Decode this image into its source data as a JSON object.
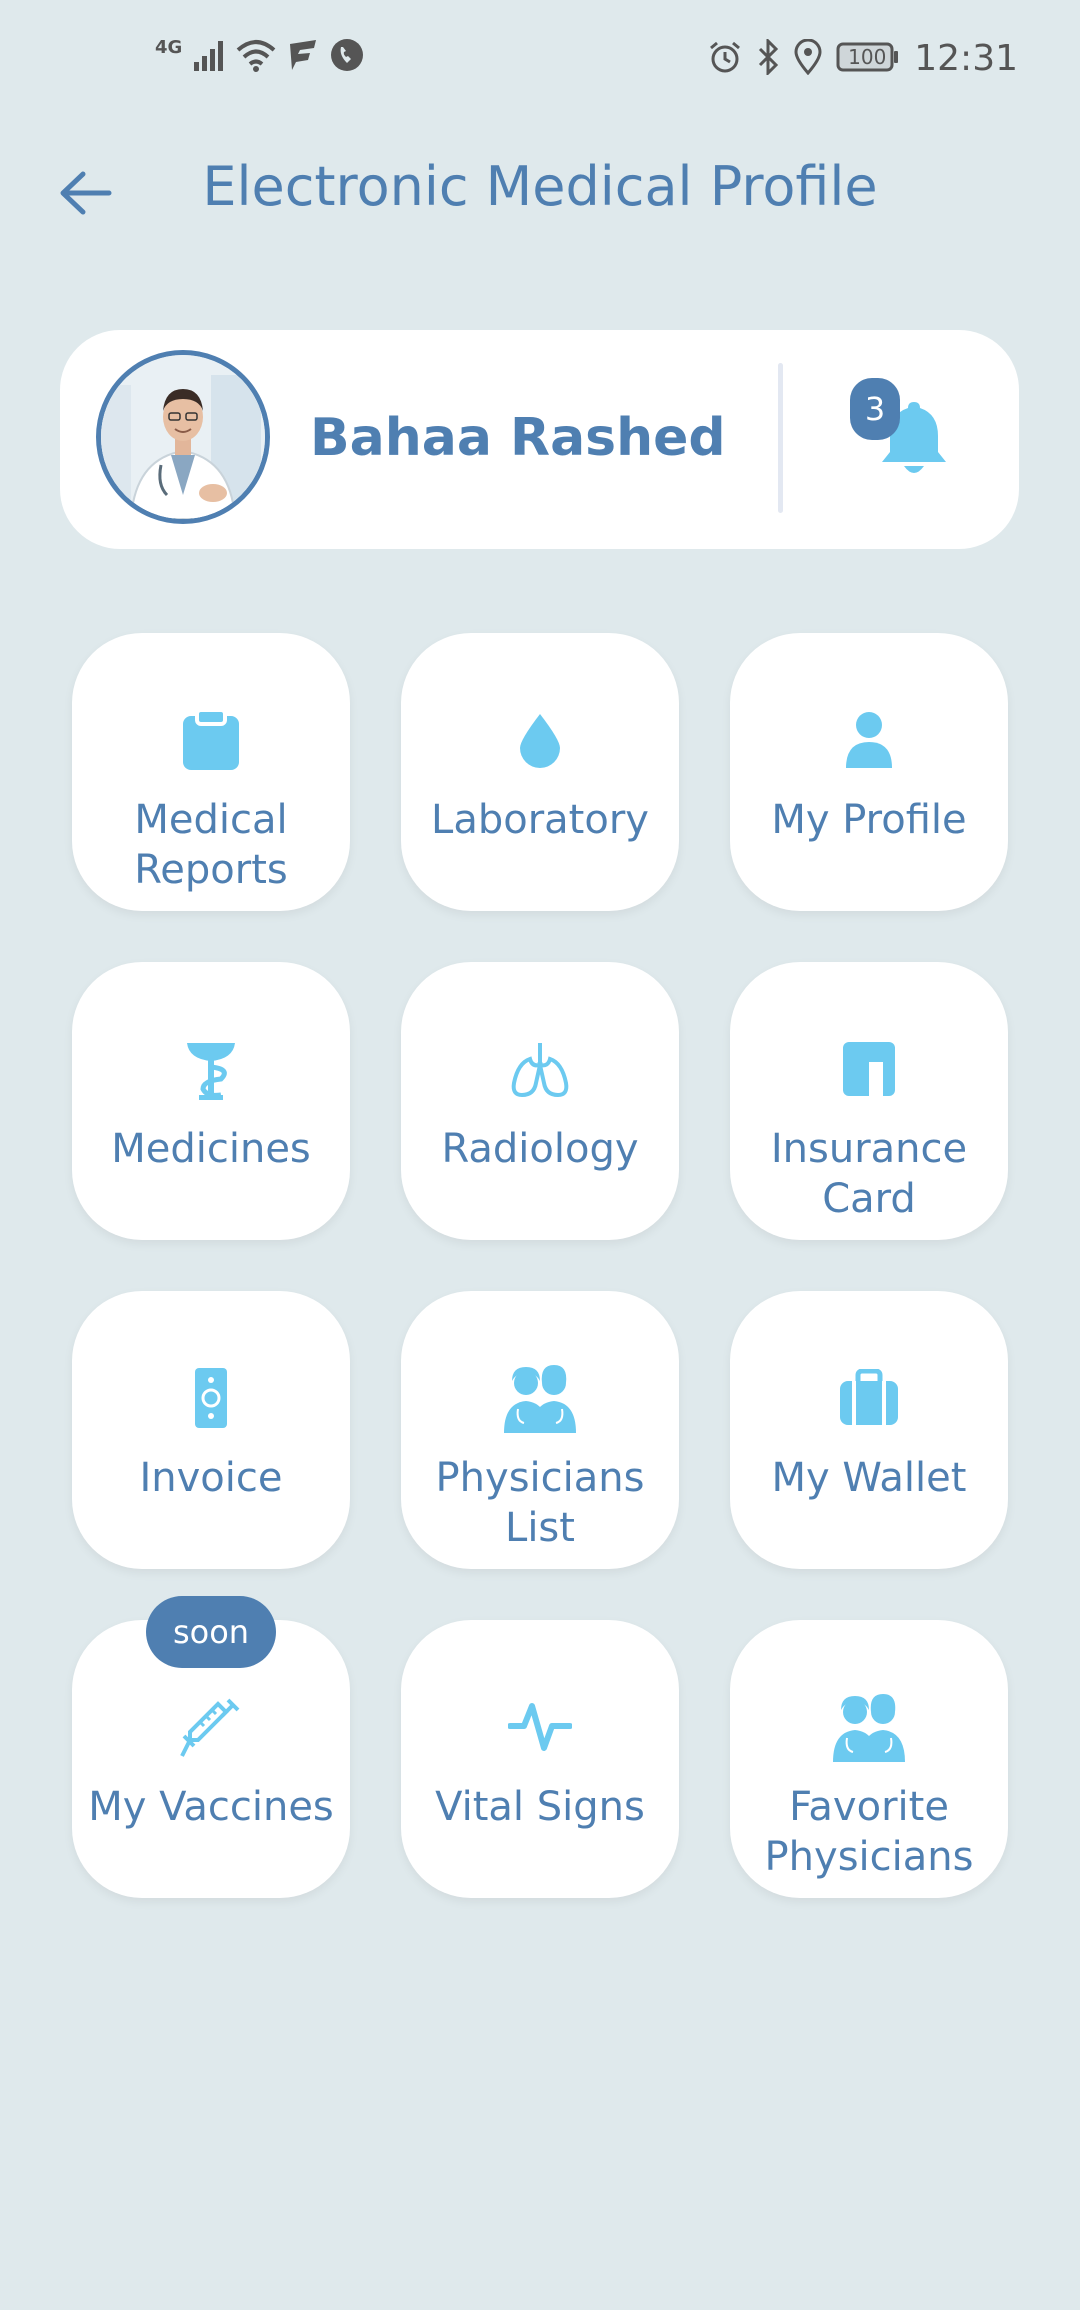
{
  "status_bar": {
    "network": "4G",
    "battery": "100",
    "time": "12:31"
  },
  "header": {
    "title": "Electronic Medical Profile"
  },
  "profile": {
    "name": "Bahaa Rashed",
    "notifications_count": "3"
  },
  "tiles": [
    {
      "label": "Medical Reports",
      "icon": "clipboard-icon"
    },
    {
      "label": "Laboratory",
      "icon": "drop-icon"
    },
    {
      "label": "My Profile",
      "icon": "person-icon"
    },
    {
      "label": "Medicines",
      "icon": "pharmacy-icon"
    },
    {
      "label": "Radiology",
      "icon": "lungs-icon"
    },
    {
      "label": "Insurance Card",
      "icon": "card-icon"
    },
    {
      "label": "Invoice",
      "icon": "invoice-icon"
    },
    {
      "label": "Physicians List",
      "icon": "physicians-icon"
    },
    {
      "label": "My Wallet",
      "icon": "wallet-icon"
    },
    {
      "label": "My Vaccines",
      "icon": "syringe-icon",
      "badge": "soon"
    },
    {
      "label": "Vital Signs",
      "icon": "pulse-icon"
    },
    {
      "label": "Favorite Physicians",
      "icon": "physicians-icon"
    }
  ],
  "colors": {
    "background": "#dfe9ec",
    "primary": "#4f7fb1",
    "icon": "#6ccaf0",
    "card": "#ffffff"
  }
}
